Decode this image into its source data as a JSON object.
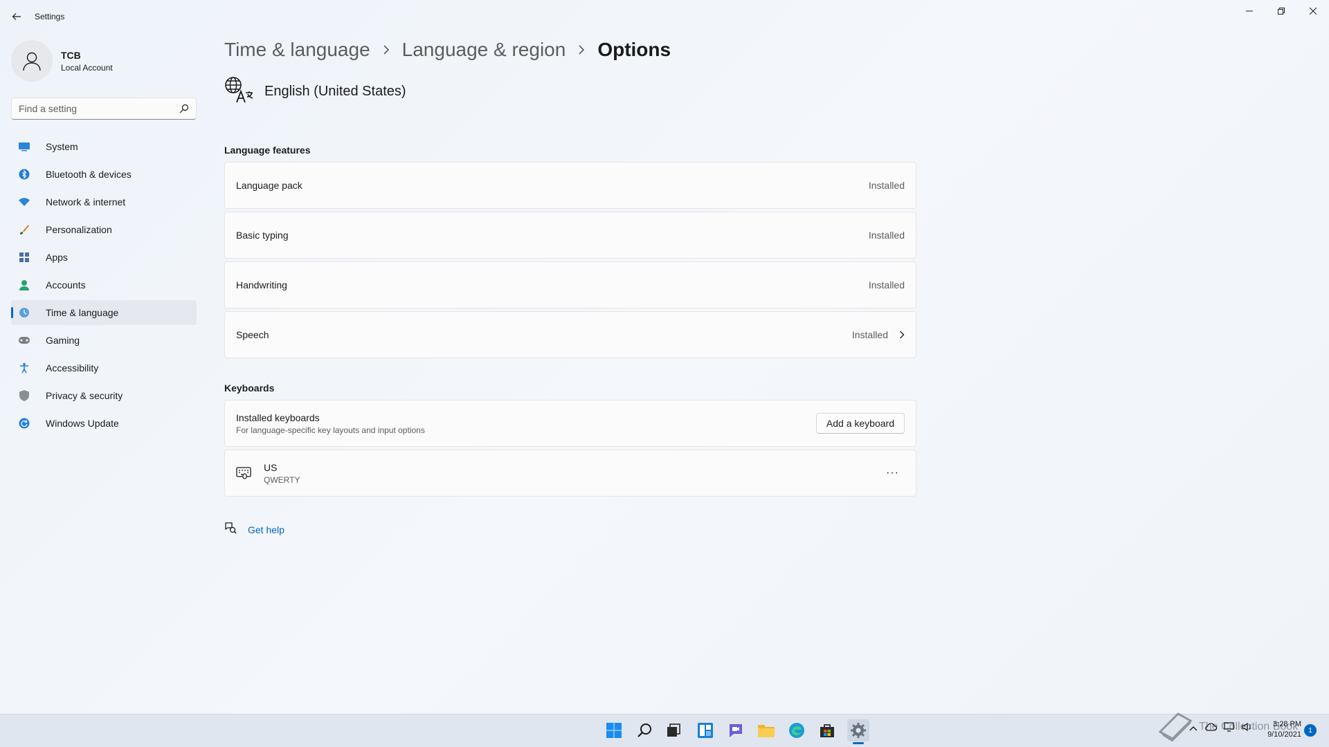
{
  "window": {
    "title": "Settings"
  },
  "profile": {
    "name": "TCB",
    "account_type": "Local Account"
  },
  "search": {
    "placeholder": "Find a setting"
  },
  "sidebar": {
    "items": [
      {
        "label": "System",
        "icon": "system-icon"
      },
      {
        "label": "Bluetooth & devices",
        "icon": "bluetooth-icon"
      },
      {
        "label": "Network & internet",
        "icon": "wifi-icon"
      },
      {
        "label": "Personalization",
        "icon": "brush-icon"
      },
      {
        "label": "Apps",
        "icon": "apps-icon"
      },
      {
        "label": "Accounts",
        "icon": "accounts-icon"
      },
      {
        "label": "Time & language",
        "icon": "globe-clock-icon",
        "active": true
      },
      {
        "label": "Gaming",
        "icon": "gamepad-icon"
      },
      {
        "label": "Accessibility",
        "icon": "accessibility-icon"
      },
      {
        "label": "Privacy & security",
        "icon": "shield-icon"
      },
      {
        "label": "Windows Update",
        "icon": "update-icon"
      }
    ]
  },
  "breadcrumb": {
    "level1": "Time & language",
    "level2": "Language & region",
    "current": "Options"
  },
  "language": {
    "name": "English (United States)"
  },
  "features": {
    "title": "Language features",
    "items": [
      {
        "label": "Language pack",
        "status": "Installed"
      },
      {
        "label": "Basic typing",
        "status": "Installed"
      },
      {
        "label": "Handwriting",
        "status": "Installed"
      },
      {
        "label": "Speech",
        "status": "Installed"
      }
    ]
  },
  "keyboards": {
    "title": "Keyboards",
    "installed_label": "Installed keyboards",
    "installed_desc": "For language-specific key layouts and input options",
    "add_button": "Add a keyboard",
    "list": [
      {
        "name": "US",
        "layout": "QWERTY"
      }
    ],
    "more_label": "···"
  },
  "help": {
    "label": "Get help"
  },
  "taskbar": {
    "time": "3:28 PM",
    "date": "9/10/2021",
    "notifications": "1",
    "watermark": "The Collection Book"
  },
  "colors": {
    "accent": "#0067c0",
    "background": "#f3f6fb",
    "card": "#fbfbfb"
  }
}
